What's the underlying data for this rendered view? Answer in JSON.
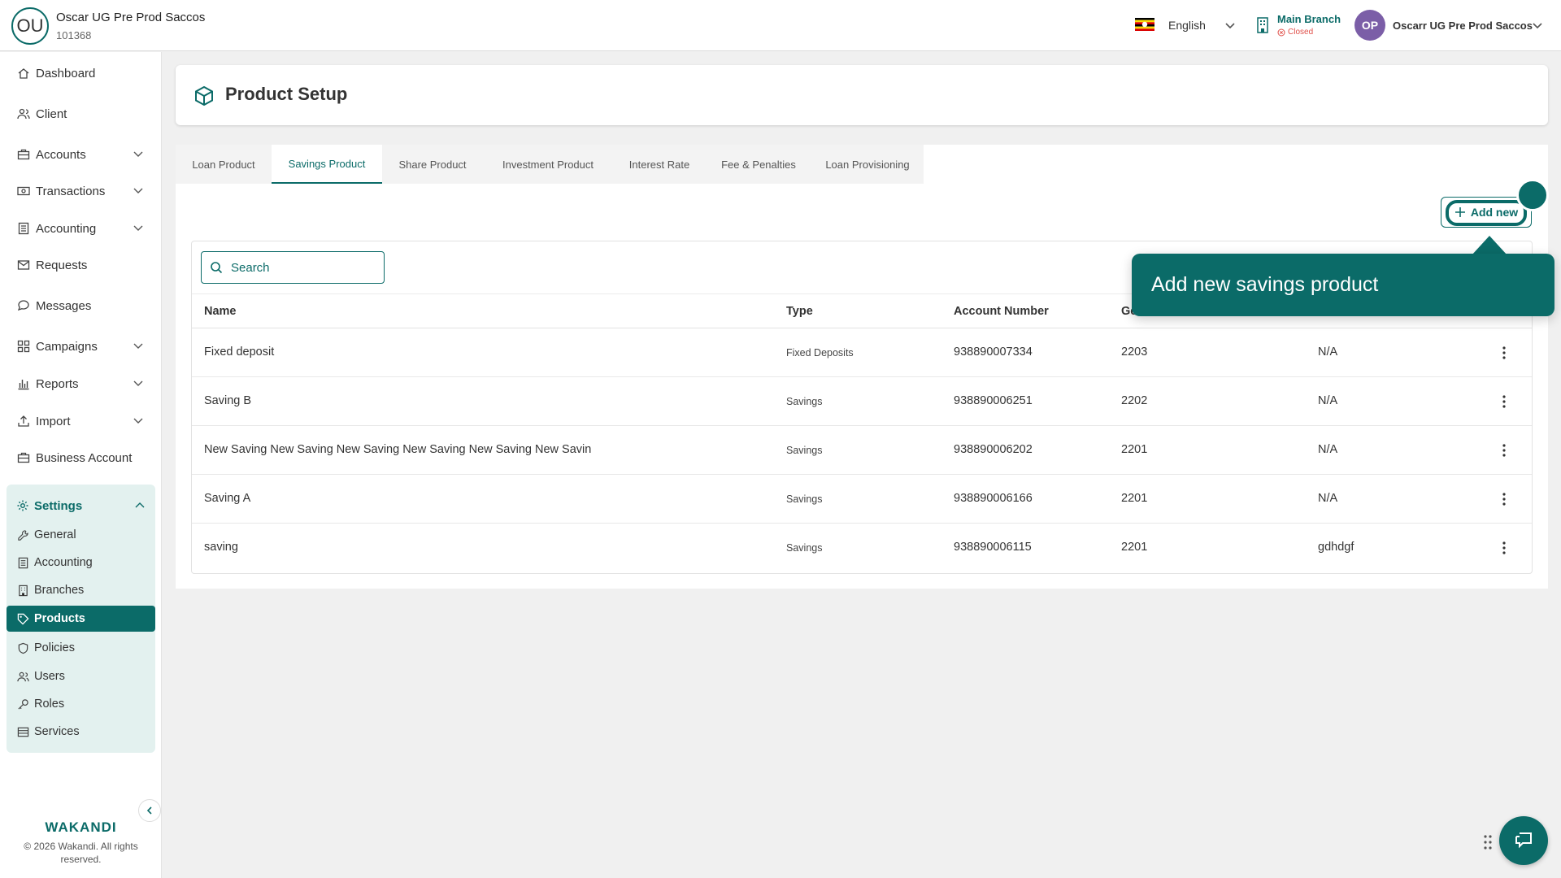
{
  "org": {
    "initials": "OU",
    "name": "Oscar UG Pre Prod Saccos",
    "code": "101368"
  },
  "topbar": {
    "language": "English",
    "branch_name": "Main Branch",
    "branch_status": "Closed",
    "user_initials": "OP",
    "user_name": "Oscarr UG Pre Prod Saccos"
  },
  "sidebar": {
    "items": [
      {
        "label": "Dashboard",
        "icon": "home-icon"
      },
      {
        "label": "Client",
        "icon": "users-icon"
      },
      {
        "label": "Accounts",
        "icon": "briefcase-icon"
      },
      {
        "label": "Transactions",
        "icon": "cash-icon"
      },
      {
        "label": "Accounting",
        "icon": "ledger-icon"
      },
      {
        "label": "Requests",
        "icon": "mail-icon"
      },
      {
        "label": "Messages",
        "icon": "chat-icon"
      },
      {
        "label": "Campaigns",
        "icon": "grid-icon"
      },
      {
        "label": "Reports",
        "icon": "bar-chart-icon"
      },
      {
        "label": "Import",
        "icon": "upload-icon"
      },
      {
        "label": "Business Account",
        "icon": "briefcase-icon"
      }
    ],
    "settings_label": "Settings",
    "settings_items": [
      {
        "label": "General",
        "icon": "wrench-icon"
      },
      {
        "label": "Accounting",
        "icon": "ledger-icon"
      },
      {
        "label": "Branches",
        "icon": "building-icon"
      },
      {
        "label": "Products",
        "icon": "tag-icon"
      },
      {
        "label": "Policies",
        "icon": "shield-icon"
      },
      {
        "label": "Users",
        "icon": "users-icon"
      },
      {
        "label": "Roles",
        "icon": "key-icon"
      },
      {
        "label": "Services",
        "icon": "list-icon"
      }
    ],
    "brand": "WAKANDI",
    "copyright": "© 2026 Wakandi. All rights reserved."
  },
  "page": {
    "title": "Product Setup"
  },
  "tabs": [
    "Loan Product",
    "Savings Product",
    "Share Product",
    "Investment Product",
    "Interest Rate",
    "Fee & Penalties",
    "Loan Provisioning"
  ],
  "active_tab": "Savings Product",
  "add_button": "Add new",
  "search": {
    "placeholder": "Search"
  },
  "table": {
    "columns": [
      "Name",
      "Type",
      "Account Number",
      "Ge"
    ],
    "rows": [
      {
        "name": "Fixed deposit",
        "type": "Fixed Deposits",
        "account": "938890007334",
        "gl": "2203",
        "other": "N/A"
      },
      {
        "name": "Saving B",
        "type": "Savings",
        "account": "938890006251",
        "gl": "2202",
        "other": "N/A"
      },
      {
        "name": "New Saving New Saving New Saving New Saving New Saving New Savin",
        "type": "Savings",
        "account": "938890006202",
        "gl": "2201",
        "other": "N/A"
      },
      {
        "name": "Saving A",
        "type": "Savings",
        "account": "938890006166",
        "gl": "2201",
        "other": "N/A"
      },
      {
        "name": "saving",
        "type": "Savings",
        "account": "938890006115",
        "gl": "2201",
        "other": "gdhdgf"
      }
    ]
  },
  "tooltip": "Add new savings product",
  "colors": {
    "primary": "#0b6b68",
    "sidebar_highlight": "#e3f1ef",
    "closed": "#e0504a"
  }
}
